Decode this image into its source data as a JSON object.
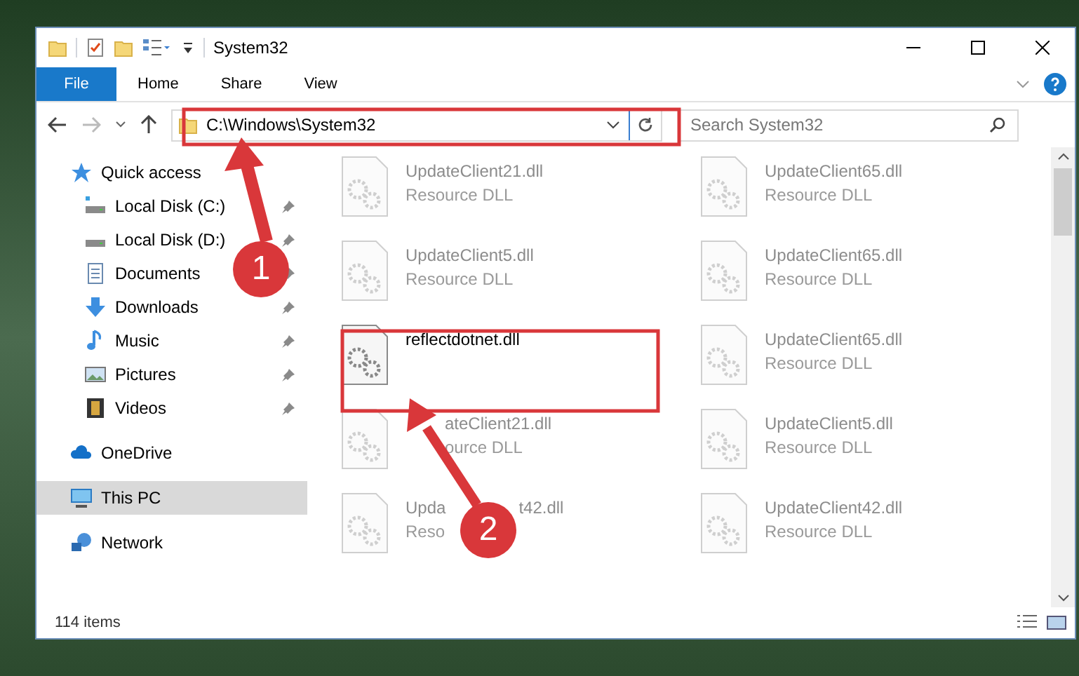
{
  "window": {
    "title": "System32"
  },
  "ribbon": {
    "file_button": "File",
    "tabs": [
      "Home",
      "Share",
      "View"
    ]
  },
  "address_bar": {
    "path": "C:\\Windows\\System32"
  },
  "search": {
    "placeholder": "Search System32"
  },
  "nav_pane": {
    "groups": [
      {
        "label": "Quick access",
        "kind": "star",
        "selected": false,
        "children": [
          {
            "label": "Local Disk (C:)",
            "kind": "system_drive",
            "pinned": true
          },
          {
            "label": "Local Disk (D:)",
            "kind": "drive",
            "pinned": true
          },
          {
            "label": "Documents",
            "kind": "documents",
            "pinned": true
          },
          {
            "label": "Downloads",
            "kind": "downloads",
            "pinned": true
          },
          {
            "label": "Music",
            "kind": "music",
            "pinned": true
          },
          {
            "label": "Pictures",
            "kind": "pictures",
            "pinned": true
          },
          {
            "label": "Videos",
            "kind": "videos",
            "pinned": true
          }
        ]
      },
      {
        "label": "OneDrive",
        "kind": "cloud",
        "selected": false
      },
      {
        "label": "This PC",
        "kind": "computer",
        "selected": true
      },
      {
        "label": "Network",
        "kind": "network",
        "selected": false
      }
    ]
  },
  "files": [
    {
      "name": [
        "UpdateClient21.dll"
      ],
      "type": [
        "Resource DLL"
      ],
      "dimmed": true
    },
    {
      "name": [
        "UpdateClient65.dll"
      ],
      "type": [
        "Resource DLL"
      ],
      "dimmed": true
    },
    {
      "name": [
        "UpdateClient5.dll"
      ],
      "type": [
        "Resource DLL"
      ],
      "dimmed": true
    },
    {
      "name": [
        "UpdateClient65.dll"
      ],
      "type": [
        "Resource DLL"
      ],
      "dimmed": true
    },
    {
      "name": [
        "reflectdotnet.dll"
      ],
      "dimmed": false
    },
    {
      "name": [
        "UpdateClient65.dll"
      ],
      "type": [
        "Resource DLL"
      ],
      "dimmed": true
    },
    {
      "name": [
        "ateClient21.dll"
      ],
      "type": [
        "ource DLL"
      ],
      "dimmed": true,
      "covered_start": true
    },
    {
      "name": [
        "UpdateClient5.dll"
      ],
      "type": [
        "Resource DLL"
      ],
      "dimmed": true
    },
    {
      "name": [
        "Upda",
        "t42.dll"
      ],
      "type": [
        "Reso"
      ],
      "dimmed": true
    },
    {
      "name": [
        "UpdateClient42.dll"
      ],
      "type": [
        "Resource DLL"
      ],
      "dimmed": true
    }
  ],
  "status_bar": {
    "item_count": "114 items"
  },
  "annotations": [
    {
      "number": "1"
    },
    {
      "number": "2"
    }
  ]
}
